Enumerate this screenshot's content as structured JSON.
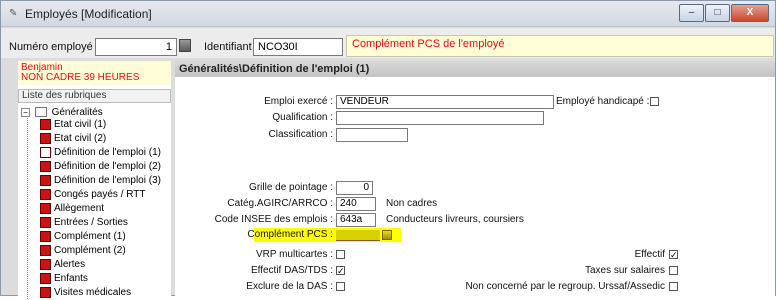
{
  "window": {
    "title": "Employés [Modification]",
    "app_icon": "app-icon",
    "buttons": {
      "minimize": "–",
      "maximize": "□",
      "close": "X"
    }
  },
  "topbar": {
    "employee_number_label": "Numéro employé :",
    "employee_number_value": "1",
    "identifier_label": "Identifiant :",
    "identifier_value": "NCO30I",
    "notice": "Complément PCS de l'employé"
  },
  "left": {
    "employee_name": "Benjamin",
    "employee_status": "NON CADRE 39 HEURES",
    "list_header": "Liste des rubriques",
    "tree_root": "Généralités",
    "items": [
      "Etat civil (1)",
      "Etat civil (2)",
      "Définition de l'emploi (1)",
      "Définition de l'emploi (2)",
      "Définition de l'emploi (3)",
      "Congés payés / RTT",
      "Allègement",
      "Entrées / Sorties",
      "Complément (1)",
      "Complément (2)",
      "Alertes",
      "Enfants",
      "Visites médicales"
    ]
  },
  "section": {
    "title": "Généralités\\Définition de l'emploi (1)",
    "emploi_label": "Emploi exercé :",
    "emploi_value": "VENDEUR",
    "handicape_label": "Employé handicapé :",
    "qualification_label": "Qualification :",
    "qualification_value": "",
    "classification_label": "Classification :",
    "classification_value": "",
    "grille_label": "Grille de pointage :",
    "grille_value": "0",
    "agirc_label": "Catég.AGIRC/ARRCO :",
    "agirc_value": "240",
    "agirc_desc": "Non cadres",
    "insee_label": "Code INSEE des emplois :",
    "insee_value": "643a",
    "insee_desc": "Conducteurs livreurs, coursiers",
    "pcs_label": "Complément PCS :",
    "vrp_label": "VRP multicartes :",
    "effectif_das_label": "Effectif DAS/TDS :",
    "exclure_label": "Exclure de la DAS :",
    "effectif_label": "Effectif",
    "taxes_label": "Taxes sur salaires",
    "non_concerne_label": "Non concerné par le regroup. Urssaf/Assedic"
  },
  "colors": {
    "notice_bg": "#fffdd8",
    "notice_text": "#e01010",
    "highlight": "#ffff00"
  }
}
